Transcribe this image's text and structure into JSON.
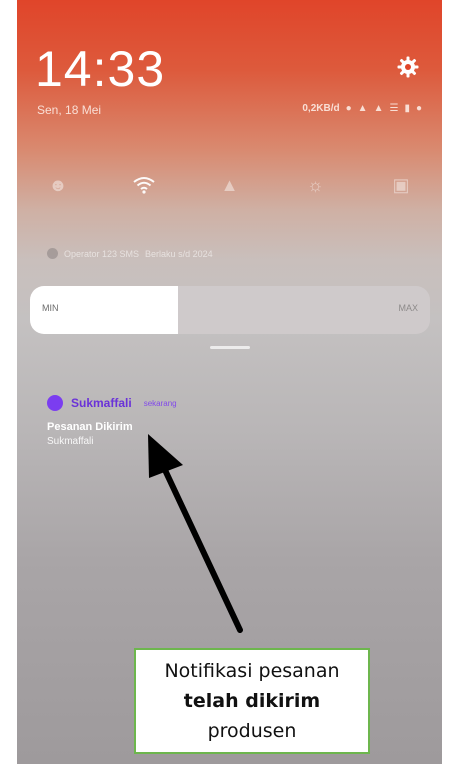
{
  "status_bar": {
    "time": "14:33",
    "date": "Sen, 18 Mei",
    "net_speed": "0,2KB/d",
    "icons": [
      "location-icon",
      "signal-icon",
      "signal-icon",
      "wifi-icon",
      "battery-icon",
      "alarm-icon"
    ]
  },
  "quick_settings": {
    "tiles": [
      "user-icon",
      "wifi-icon",
      "flashlight-icon",
      "brightness-icon",
      "screen-icon"
    ]
  },
  "info_line": {
    "text1": "Operator 123 SMS",
    "text2": "Berlaku s/d 2024"
  },
  "brightness": {
    "min_label": "MIN",
    "max_label": "MAX",
    "level": 0.37
  },
  "notification": {
    "app_name": "Sukmaffali",
    "time": "sekarang",
    "title": "Pesanan Dikirim",
    "body": "Sukmaffali"
  },
  "callout": {
    "line1": "Notifikasi pesanan",
    "line2": "telah dikirim",
    "line3": "produsen",
    "border_color": "#6db64d"
  },
  "colors": {
    "accent": "#7b3df0",
    "header": "#e0452a"
  }
}
